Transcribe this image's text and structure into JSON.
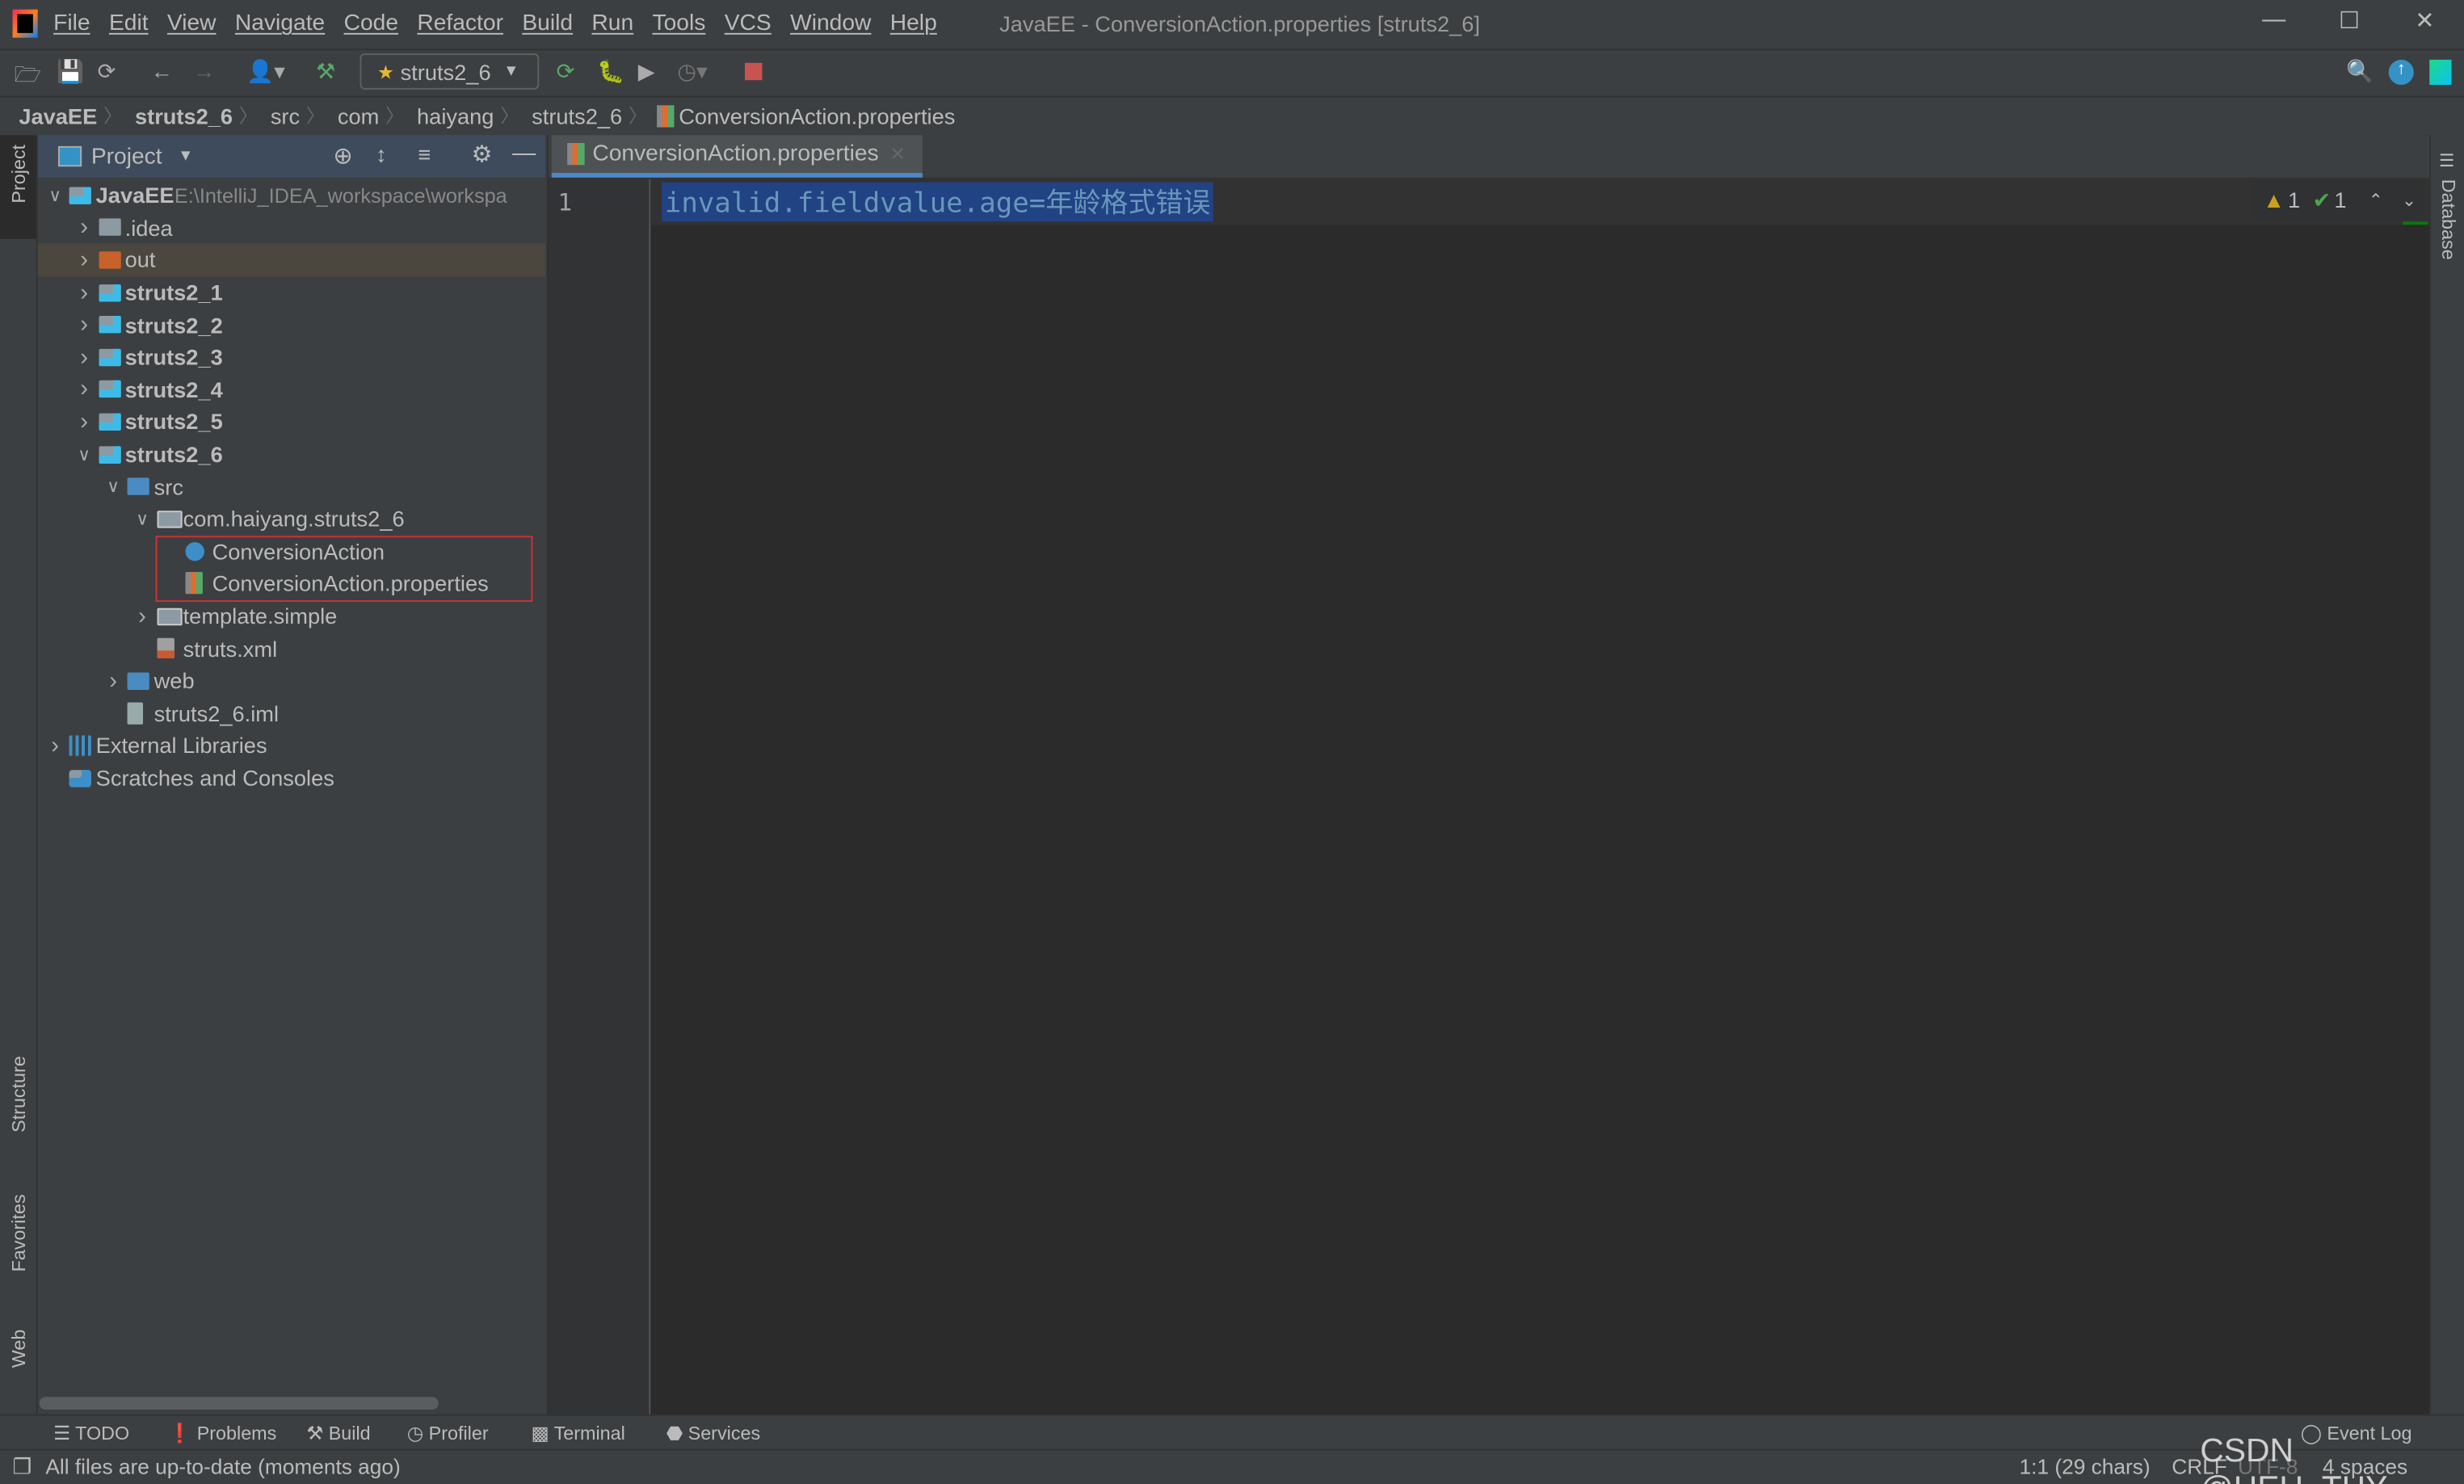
{
  "menubar": {
    "items": [
      "File",
      "Edit",
      "View",
      "Navigate",
      "Code",
      "Refactor",
      "Build",
      "Run",
      "Tools",
      "VCS",
      "Window",
      "Help"
    ],
    "window_title": "JavaEE - ConversionAction.properties [struts2_6]"
  },
  "toolbar": {
    "run_config": "struts2_6"
  },
  "breadcrumb": [
    "JavaEE",
    "struts2_6",
    "src",
    "com",
    "haiyang",
    "struts2_6",
    "ConversionAction.properties"
  ],
  "side_left": {
    "project": "Project",
    "structure": "Structure",
    "favorites": "Favorites",
    "web": "Web"
  },
  "side_right": {
    "database": "Database"
  },
  "project_panel": {
    "title": "Project",
    "tree": [
      {
        "label": "JavaEE",
        "path": "E:\\IntelliJ_IDEA_workspace\\workspa",
        "level": 0,
        "expanded": true,
        "icon": "module-folder",
        "bold": true
      },
      {
        "label": ".idea",
        "level": 1,
        "expanded": false,
        "icon": "folder"
      },
      {
        "label": "out",
        "level": 1,
        "expanded": false,
        "icon": "excluded-folder",
        "highlight": true
      },
      {
        "label": "struts2_1",
        "level": 1,
        "expanded": false,
        "icon": "module-folder",
        "bold": true
      },
      {
        "label": "struts2_2",
        "level": 1,
        "expanded": false,
        "icon": "module-folder",
        "bold": true
      },
      {
        "label": "struts2_3",
        "level": 1,
        "expanded": false,
        "icon": "module-folder",
        "bold": true
      },
      {
        "label": "struts2_4",
        "level": 1,
        "expanded": false,
        "icon": "module-folder",
        "bold": true
      },
      {
        "label": "struts2_5",
        "level": 1,
        "expanded": false,
        "icon": "module-folder",
        "bold": true
      },
      {
        "label": "struts2_6",
        "level": 1,
        "expanded": true,
        "icon": "module-folder",
        "bold": true
      },
      {
        "label": "src",
        "level": 2,
        "expanded": true,
        "icon": "source-folder"
      },
      {
        "label": "com.haiyang.struts2_6",
        "level": 3,
        "expanded": true,
        "icon": "package"
      },
      {
        "label": "ConversionAction",
        "level": 4,
        "icon": "java-class"
      },
      {
        "label": "ConversionAction.properties",
        "level": 4,
        "icon": "properties-file"
      },
      {
        "label": "template.simple",
        "level": 3,
        "expanded": false,
        "icon": "package"
      },
      {
        "label": "struts.xml",
        "level": 3,
        "icon": "xml-file"
      },
      {
        "label": "web",
        "level": 2,
        "expanded": false,
        "icon": "web-folder"
      },
      {
        "label": "struts2_6.iml",
        "level": 2,
        "icon": "iml-file"
      },
      {
        "label": "External Libraries",
        "level": 0,
        "expanded": false,
        "icon": "libraries"
      },
      {
        "label": "Scratches and Consoles",
        "level": 0,
        "icon": "scratches"
      }
    ]
  },
  "editor": {
    "tab": "ConversionAction.properties",
    "line_number": "1",
    "code": "invalid.fieldvalue.age=年龄格式错误",
    "warnings": "1",
    "weak_warnings": "1"
  },
  "toolwindows": [
    "TODO",
    "Problems",
    "Build",
    "Profiler",
    "Terminal",
    "Services"
  ],
  "event_log": "Event Log",
  "status": {
    "message": "All files are up-to-date (moments ago)",
    "position": "1:1 (29 chars)",
    "line_sep": "CRLF",
    "encoding": "UTF-8",
    "indent": "4 spaces"
  },
  "watermark": "CSDN @HEU_THY",
  "colors": {
    "editor_bg": "#2b2b2b",
    "panel_bg": "#3c3f41",
    "selection": "#214283",
    "warning": "#c9a01e",
    "ok": "#4ca64c",
    "stop": "#c75450"
  }
}
